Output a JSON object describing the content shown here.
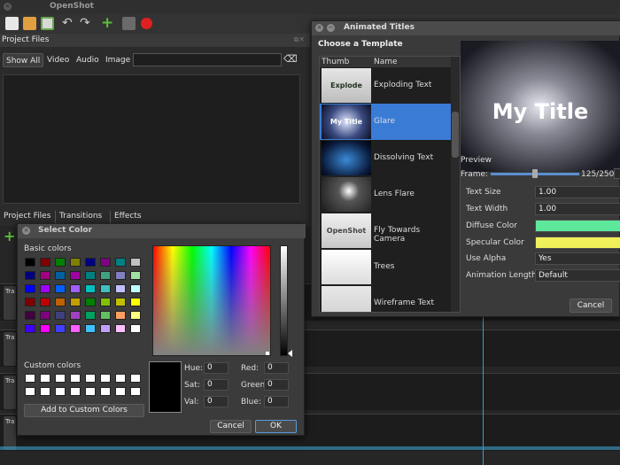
{
  "app": {
    "title": "OpenShot"
  },
  "project_files": {
    "header": "Project Files",
    "filters": [
      "Show All",
      "Video",
      "Audio",
      "Image"
    ],
    "tabs": [
      "Project Files",
      "Transitions",
      "Effects"
    ]
  },
  "timeline": {
    "track_label": "Tra"
  },
  "animated_titles": {
    "title": "Animated Titles",
    "choose_label": "Choose a Template",
    "columns": [
      "Thumb",
      "Name"
    ],
    "templates": [
      "Exploding Text",
      "Glare",
      "Dissolving Text",
      "Lens Flare",
      "Fly Towards Camera",
      "Trees",
      "Wireframe Text"
    ],
    "selected_index": 1,
    "thumb_texts": [
      "Explode",
      "My Title",
      "",
      "",
      "OpenShot Title",
      "",
      ""
    ],
    "preview_text": "My Title",
    "preview_label": "Preview",
    "frame_label": "Frame:",
    "frame_value": "125/250",
    "frame_fraction": 0.5,
    "props": [
      {
        "label": "Text Size",
        "value": "1.00"
      },
      {
        "label": "Text Width",
        "value": "1.00"
      },
      {
        "label": "Diffuse Color",
        "value": "",
        "color": "#5de89c"
      },
      {
        "label": "Specular Color",
        "value": "",
        "color": "#f0f05a"
      },
      {
        "label": "Use Alpha",
        "value": "Yes"
      },
      {
        "label": "Animation Length",
        "value": "Default"
      }
    ],
    "cancel": "Cancel"
  },
  "select_color": {
    "title": "Select Color",
    "basic_label": "Basic colors",
    "basic_colors": [
      [
        "#000000",
        "#800000",
        "#008000",
        "#808000",
        "#000080",
        "#800080",
        "#008080",
        "#c0c0c0"
      ],
      [
        "#000080",
        "#a00080",
        "#0060a0",
        "#a000a0",
        "#008080",
        "#40a080",
        "#8080c0",
        "#a0e0a0"
      ],
      [
        "#0000ff",
        "#a000ff",
        "#0060ff",
        "#a060ff",
        "#00c0c0",
        "#40c0c0",
        "#c0c0ff",
        "#c0ffff"
      ],
      [
        "#800000",
        "#c00000",
        "#c06000",
        "#c0a000",
        "#008000",
        "#80c000",
        "#c0c000",
        "#ffff00"
      ],
      [
        "#400040",
        "#800080",
        "#404080",
        "#a040c0",
        "#00a060",
        "#60c060",
        "#ffa060",
        "#ffff80"
      ],
      [
        "#4000ff",
        "#ff00ff",
        "#4040ff",
        "#ff60ff",
        "#40c0ff",
        "#c0a0ff",
        "#ffc0ff",
        "#ffffff"
      ]
    ],
    "custom_label": "Custom colors",
    "add_custom": "Add to Custom Colors",
    "fields": [
      {
        "label": "Hue:",
        "value": "0"
      },
      {
        "label": "Sat:",
        "value": "0"
      },
      {
        "label": "Val:",
        "value": "0"
      },
      {
        "label": "Red:",
        "value": "0"
      },
      {
        "label": "Green:",
        "value": "0"
      },
      {
        "label": "Blue:",
        "value": "0"
      }
    ],
    "current_color": "#000000",
    "cancel": "Cancel",
    "ok": "OK"
  }
}
